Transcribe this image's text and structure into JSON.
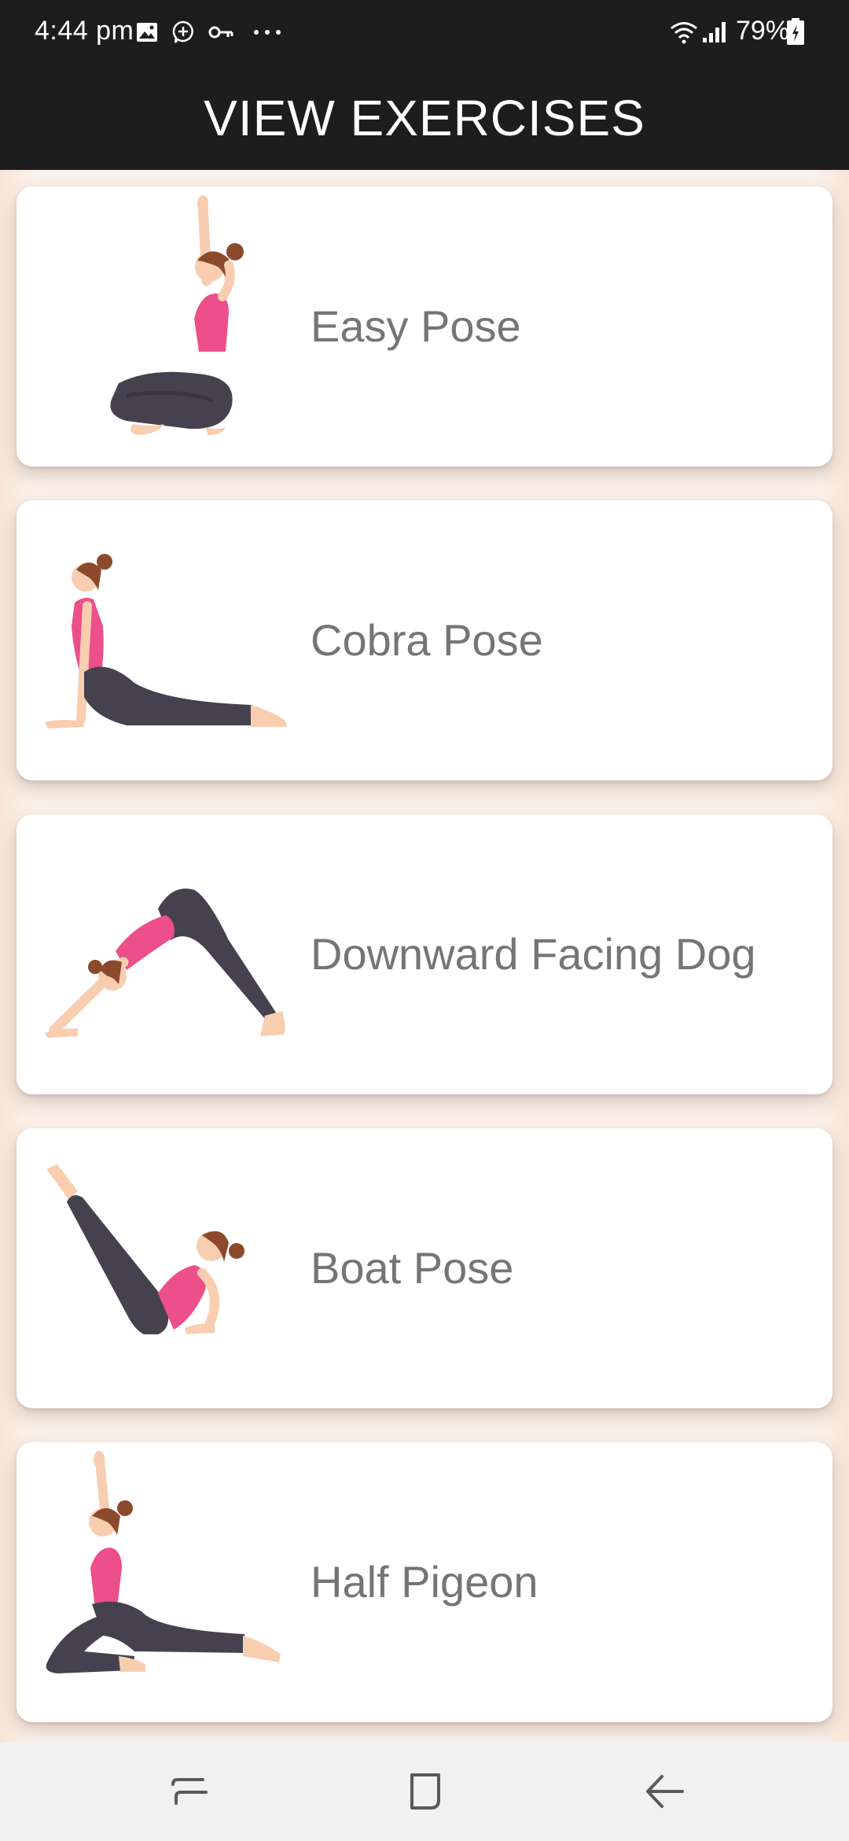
{
  "status_bar": {
    "time": "4:44 pm",
    "battery": "79%",
    "icons": [
      "image-icon",
      "chat-add-icon",
      "key-icon",
      "more-dots-icon",
      "wifi-icon",
      "signal-icon",
      "battery-icon"
    ]
  },
  "app_bar": {
    "title": "VIEW EXERCISES"
  },
  "exercises": [
    {
      "label": "Easy Pose",
      "illustration": "easy-pose-illustration"
    },
    {
      "label": "Cobra Pose",
      "illustration": "cobra-pose-illustration"
    },
    {
      "label": "Downward Facing Dog",
      "illustration": "downward-dog-illustration"
    },
    {
      "label": "Boat Pose",
      "illustration": "boat-pose-illustration"
    },
    {
      "label": "Half Pigeon",
      "illustration": "half-pigeon-illustration"
    }
  ],
  "nav_bar": {
    "buttons": [
      "recents-icon",
      "home-icon",
      "back-icon"
    ]
  },
  "colors": {
    "bars": "#1d1d1d",
    "background": "#fbf1ea",
    "card": "#ffffff",
    "label_text": "#757575",
    "top_pink": "#ec4f8a",
    "pants": "#46414f",
    "skin": "#f8cdb0",
    "hair": "#8b4a2b"
  }
}
